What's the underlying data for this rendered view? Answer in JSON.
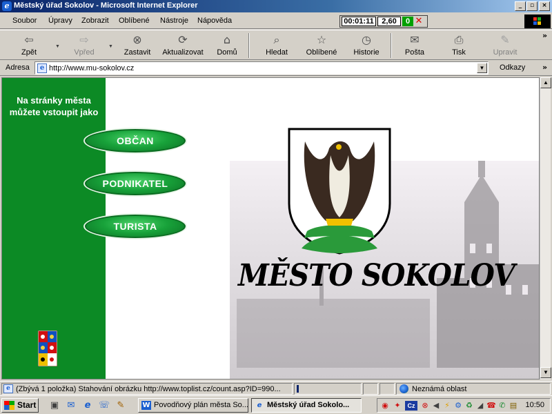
{
  "window": {
    "title": "Městský úřad Sokolov - Microsoft Internet Explorer",
    "controls": {
      "minimize": "_",
      "maximize": "▫",
      "close": "×"
    }
  },
  "menu": [
    "Soubor",
    "Úpravy",
    "Zobrazit",
    "Oblíbené",
    "Nástroje",
    "Nápověda"
  ],
  "meter": {
    "time": "00:01:11",
    "speed": "2,60",
    "count": "0"
  },
  "toolbar": {
    "buttons": [
      {
        "label": "Zpět",
        "icon": "back-arrow-icon",
        "glyph": "⇦"
      },
      {
        "label": "Vpřed",
        "icon": "forward-arrow-icon",
        "glyph": "⇨"
      },
      {
        "label": "Zastavit",
        "icon": "stop-icon",
        "glyph": "⊗"
      },
      {
        "label": "Aktualizovat",
        "icon": "refresh-icon",
        "glyph": "⟳"
      },
      {
        "label": "Domů",
        "icon": "home-icon",
        "glyph": "⌂"
      },
      {
        "label": "Hledat",
        "icon": "search-icon",
        "glyph": "⌕"
      },
      {
        "label": "Oblíbené",
        "icon": "favorites-icon",
        "glyph": "☆"
      },
      {
        "label": "Historie",
        "icon": "history-icon",
        "glyph": "◷"
      },
      {
        "label": "Pošta",
        "icon": "mail-icon",
        "glyph": "✉"
      },
      {
        "label": "Tisk",
        "icon": "print-icon",
        "glyph": "⎙"
      },
      {
        "label": "Upravit",
        "icon": "edit-icon",
        "glyph": "✎"
      }
    ]
  },
  "address": {
    "label": "Adresa",
    "url": "http://www.mu-sokolov.cz",
    "links_label": "Odkazy"
  },
  "page": {
    "sidebar_caption": "Na stránky města můžete vstoupit jako",
    "entry_buttons": [
      "OBČAN",
      "PODNIKATEL",
      "TURISTA"
    ],
    "city_title": "MĚSTO SOKOLOV"
  },
  "status": {
    "text": "(Zbývá 1 položka) Stahování obrázku http://www.toplist.cz/count.asp?ID=990...",
    "zone": "Neznámá oblast"
  },
  "taskbar": {
    "start": "Start",
    "tasks": [
      "Povodňový plán města So...",
      "Městský úřad Sokolo..."
    ],
    "tray_lang": "Cz",
    "clock": "10:50"
  },
  "colors": {
    "sidebar_green": "#0c8a25",
    "titlebar": "#0a246a"
  }
}
